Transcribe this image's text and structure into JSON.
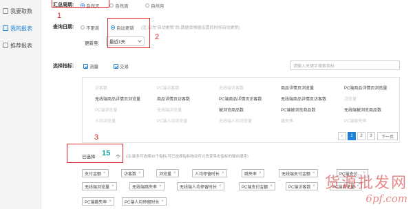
{
  "sidebar": {
    "items": [
      {
        "label": "我要取数"
      },
      {
        "label": "我的报表"
      },
      {
        "label": "推荐报表"
      }
    ]
  },
  "summary": {
    "label": "汇总周期:",
    "options": [
      "自然天",
      "自然周",
      "自然月"
    ],
    "selected": "自然天"
  },
  "query_date": {
    "label": "查询日期:",
    "options": [
      "不更新",
      "自动更新"
    ],
    "selected": "自动更新",
    "hint": "(注:设为\"自动更新\"后,数据会根据设置的时间自动更新)",
    "update_label": "更新至:",
    "update_value": "最近1天"
  },
  "metrics": {
    "label": "选择指标:",
    "checks": [
      "流量",
      "交易"
    ],
    "search_placeholder": "请输入关键字搜索指标",
    "grid": [
      [
        "访客数",
        "PC端访客数",
        "无线端访客数",
        "商品详情页浏览量",
        "PC端商品详情页浏览量"
      ],
      [
        "无线端商品详情页浏览量",
        "商品详情页访客数",
        "PC端商品详情页访客数",
        "无线端商品详情页访客数",
        "浏览量"
      ],
      [
        "PC端浏览量",
        "无线端浏览量",
        "被浏览商品数",
        "PC端被浏览商品数",
        "无线端被浏览商品数"
      ],
      [
        "人均浏览量",
        "PC端人均浏览量",
        "无线端人均浏览量",
        "跳失率",
        "PC端跳失率"
      ]
    ],
    "pager": [
      "1",
      "2",
      "3",
      "下一页"
    ]
  },
  "selected": {
    "prefix": "已选择",
    "count": "15",
    "unit": "个",
    "note": "(注:最多可选择30个指标,可已选择指标拖动可以改变导出指标的输出顺序)",
    "tags": [
      [
        "支付金额",
        "访客数",
        "浏览量",
        "人均停留时长",
        "跳失率",
        "无线端支付金额",
        "PC端支付..."
      ],
      [
        "无线端浏览量",
        "无线端跳失率",
        "无线端人均停留时长",
        "PC端支付金额",
        "PC端访客数",
        "PC端浏览量"
      ],
      [
        "PC端跳失率",
        "PC端人均停留时长"
      ]
    ]
  },
  "annotations": [
    "1",
    "2",
    "3"
  ],
  "watermark": {
    "line1": "货源批发网",
    "line2": "6pf.com"
  },
  "colors": {
    "accent": "#1e7fd6",
    "annotation_red": "#e0262c",
    "count_teal": "#1aa0a0"
  }
}
